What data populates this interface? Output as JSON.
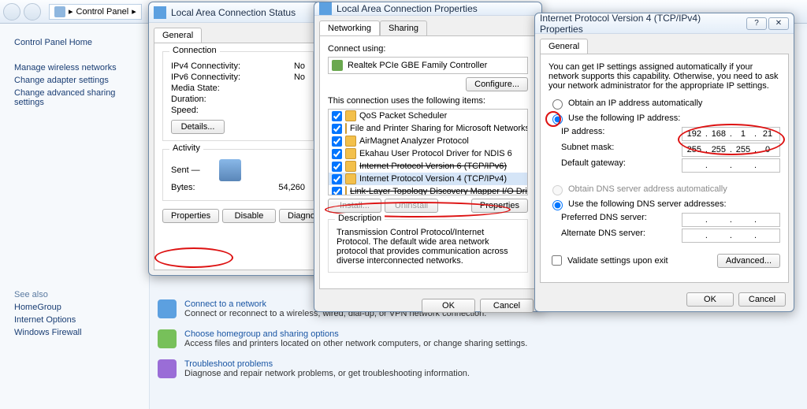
{
  "breadcrumb": {
    "label": "Control Panel",
    "chevron": "▸"
  },
  "sidebar": {
    "home": "Control Panel Home",
    "links": [
      "Manage wireless networks",
      "Change adapter settings",
      "Change advanced sharing settings"
    ],
    "seealso_title": "See also",
    "seealso": [
      "HomeGroup",
      "Internet Options",
      "Windows Firewall"
    ]
  },
  "tasks": [
    {
      "title": "Connect to a network",
      "desc": "Connect or reconnect to a wireless, wired, dial-up, or VPN network connection."
    },
    {
      "title": "Choose homegroup and sharing options",
      "desc": "Access files and printers located on other network computers, or change sharing settings."
    },
    {
      "title": "Troubleshoot problems",
      "desc": "Diagnose and repair network problems, or get troubleshooting information."
    }
  ],
  "status_dialog": {
    "title": "Local Area Connection Status",
    "tab": "General",
    "group_conn": "Connection",
    "rows": {
      "ipv4_lbl": "IPv4 Connectivity:",
      "ipv4_val": "No",
      "ipv6_lbl": "IPv6 Connectivity:",
      "ipv6_val": "No",
      "media_lbl": "Media State:",
      "media_val": "",
      "dur_lbl": "Duration:",
      "dur_val": "",
      "speed_lbl": "Speed:",
      "speed_val": ""
    },
    "details_btn": "Details...",
    "group_act": "Activity",
    "act": {
      "sent": "Sent  —",
      "bytes_lbl": "Bytes:",
      "bytes_val": "54,260"
    },
    "btns": {
      "properties": "Properties",
      "disable": "Disable",
      "diagnose": "Diagnose"
    }
  },
  "props_dialog": {
    "title": "Local Area Connection Properties",
    "tab1": "Networking",
    "tab2": "Sharing",
    "connect_using": "Connect using:",
    "adapter": "Realtek PCIe GBE Family Controller",
    "configure": "Configure...",
    "uses": "This connection uses the following items:",
    "items": [
      {
        "label": "QoS Packet Scheduler",
        "checked": true,
        "strike": false
      },
      {
        "label": "File and Printer Sharing for Microsoft Networks",
        "checked": true,
        "strike": false
      },
      {
        "label": "AirMagnet Analyzer Protocol",
        "checked": true,
        "strike": false
      },
      {
        "label": "Ekahau User Protocol Driver for NDIS 6",
        "checked": true,
        "strike": false
      },
      {
        "label": "Internet Protocol Version 6 (TCP/IPv6)",
        "checked": true,
        "strike": true
      },
      {
        "label": "Internet Protocol Version 4 (TCP/IPv4)",
        "checked": true,
        "strike": false,
        "selected": true
      },
      {
        "label": "Link-Layer Topology Discovery Mapper I/O Driver",
        "checked": true,
        "strike": true
      }
    ],
    "install": "Install...",
    "uninstall": "Uninstall",
    "properties": "Properties",
    "desc_lbl": "Description",
    "desc": "Transmission Control Protocol/Internet Protocol. The default wide area network protocol that provides communication across diverse interconnected networks.",
    "ok": "OK",
    "cancel": "Cancel"
  },
  "ipv4_dialog": {
    "title": "Internet Protocol Version 4 (TCP/IPv4) Properties",
    "tab": "General",
    "intro": "You can get IP settings assigned automatically if your network supports this capability. Otherwise, you need to ask your network administrator for the appropriate IP settings.",
    "r_auto_ip": "Obtain an IP address automatically",
    "r_use_ip": "Use the following IP address:",
    "ip_lbl": "IP address:",
    "ip": [
      "192",
      "168",
      "1",
      "21"
    ],
    "mask_lbl": "Subnet mask:",
    "mask": [
      "255",
      "255",
      "255",
      "0"
    ],
    "gw_lbl": "Default gateway:",
    "gw": [
      "",
      "",
      "",
      ""
    ],
    "r_auto_dns": "Obtain DNS server address automatically",
    "r_use_dns": "Use the following DNS server addresses:",
    "pdns_lbl": "Preferred DNS server:",
    "pdns": [
      "",
      "",
      "",
      ""
    ],
    "adns_lbl": "Alternate DNS server:",
    "adns": [
      "",
      "",
      "",
      ""
    ],
    "validate": "Validate settings upon exit",
    "advanced": "Advanced...",
    "ok": "OK",
    "cancel": "Cancel",
    "help": "?",
    "close": "✕"
  }
}
